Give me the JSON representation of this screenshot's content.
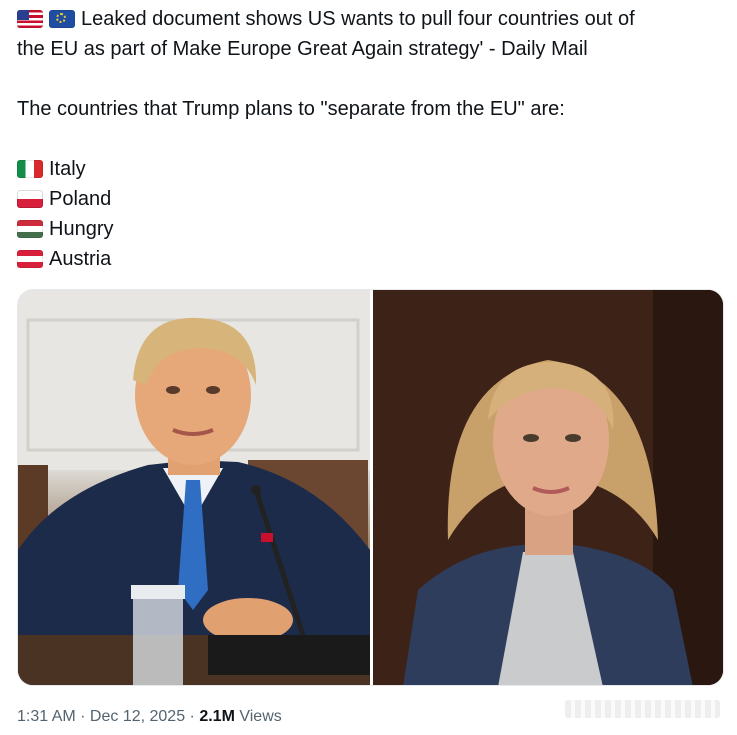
{
  "tweet": {
    "headline_line1": "Leaked document shows US wants to pull four countries out of",
    "headline_line2": "the EU as part of Make Europe Great Again strategy' - Daily Mail",
    "intro": "The countries that Trump plans to \"separate from the EU\" are:",
    "countries": [
      {
        "name": "Italy",
        "flag": "italy-flag"
      },
      {
        "name": "Poland",
        "flag": "poland-flag"
      },
      {
        "name": "Hungry",
        "flag": "hungary-flag"
      },
      {
        "name": "Austria",
        "flag": "austria-flag"
      }
    ],
    "headline_flags": [
      "us-flag",
      "eu-flag"
    ]
  },
  "media": {
    "photos": [
      {
        "subject": "man in navy suit and blue tie seated at table with microphone"
      },
      {
        "subject": "woman with wavy blonde hair in blue tweed blazer"
      }
    ]
  },
  "footer": {
    "time": "1:31 AM",
    "sep1": " · ",
    "date": "Dec 12, 2025",
    "sep2": " · ",
    "views_count": "2.1M",
    "views_label": " Views"
  }
}
